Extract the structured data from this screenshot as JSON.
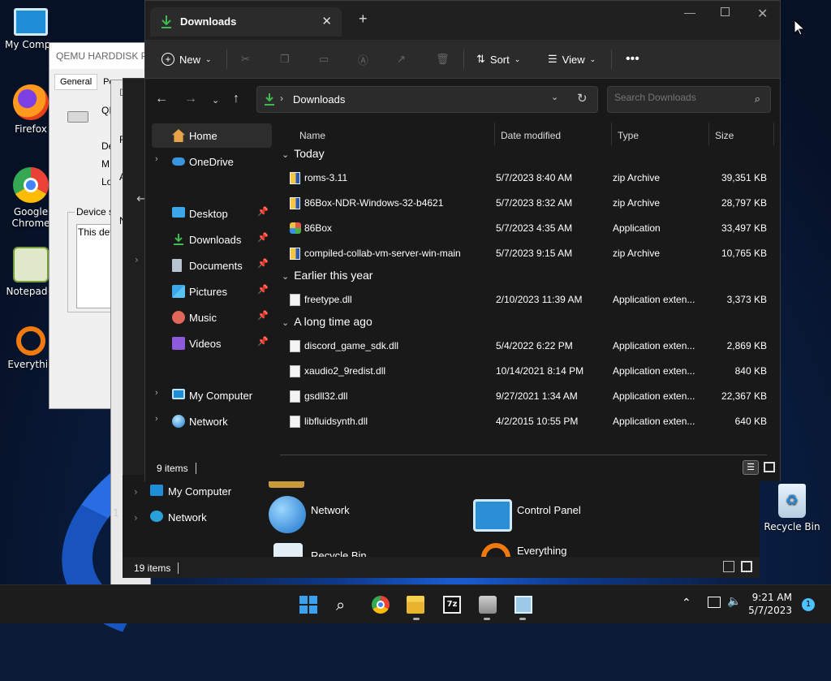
{
  "desktop": {
    "icons": [
      {
        "label": "My Compu",
        "icon": "monitor-icon"
      },
      {
        "label": "Firefox",
        "icon": "firefox-icon"
      },
      {
        "label": "Google Chrome",
        "icon": "chrome-icon"
      },
      {
        "label": "Notepad+",
        "icon": "notepad-plus-icon"
      },
      {
        "label": "Everythin",
        "icon": "everything-icon"
      },
      {
        "label": "Recycle Bin",
        "icon": "recycle-bin-icon"
      }
    ]
  },
  "props_window": {
    "title": "QEMU HARDDISK Pr",
    "tabs": [
      "General",
      "Po"
    ],
    "partial": [
      "QI",
      "De",
      "M",
      "Lo",
      "Device st",
      "This devi"
    ]
  },
  "back_explorer": {
    "partial": [
      "Di",
      "F",
      "A",
      "N"
    ],
    "sidebar": [
      {
        "label": "My Computer",
        "icon": "monitor-icon"
      },
      {
        "label": "Network",
        "icon": "network-icon"
      }
    ],
    "tiles": [
      {
        "label": "Network",
        "icon": "network-icon"
      },
      {
        "label": "Control Panel",
        "icon": "control-panel-icon"
      },
      {
        "label": "Recycle Bin",
        "icon": "recycle-bin-icon"
      },
      {
        "label": "Everything",
        "icon": "everything-icon"
      }
    ],
    "status": "19 items",
    "side_status": "1"
  },
  "explorer": {
    "tab_title": "Downloads",
    "toolbar": {
      "new": "New",
      "sort": "Sort",
      "view": "View"
    },
    "address": {
      "segment": "Downloads"
    },
    "search_placeholder": "Search Downloads",
    "sidebar": {
      "home": "Home",
      "onedrive": "OneDrive",
      "quick": [
        {
          "label": "Desktop",
          "icon": "desktop-icon"
        },
        {
          "label": "Downloads",
          "icon": "download-icon"
        },
        {
          "label": "Documents",
          "icon": "documents-icon"
        },
        {
          "label": "Pictures",
          "icon": "pictures-icon"
        },
        {
          "label": "Music",
          "icon": "music-icon"
        },
        {
          "label": "Videos",
          "icon": "videos-icon"
        }
      ],
      "mycomputer": "My Computer",
      "network": "Network"
    },
    "columns": {
      "name": "Name",
      "date": "Date modified",
      "type": "Type",
      "size": "Size"
    },
    "groups": [
      {
        "label": "Today",
        "files": [
          {
            "name": "roms-3.11",
            "date": "5/7/2023 8:40 AM",
            "type": "zip Archive",
            "size": "39,351 KB",
            "icon": "zip-icon"
          },
          {
            "name": "86Box-NDR-Windows-32-b4621",
            "date": "5/7/2023 8:32 AM",
            "type": "zip Archive",
            "size": "28,797 KB",
            "icon": "zip-icon"
          },
          {
            "name": "86Box",
            "date": "5/7/2023 4:35 AM",
            "type": "Application",
            "size": "33,497 KB",
            "icon": "app-icon"
          },
          {
            "name": "compiled-collab-vm-server-win-main",
            "date": "5/7/2023 9:15 AM",
            "type": "zip Archive",
            "size": "10,765 KB",
            "icon": "zip-icon"
          }
        ]
      },
      {
        "label": "Earlier this year",
        "files": [
          {
            "name": "freetype.dll",
            "date": "2/10/2023 11:39 AM",
            "type": "Application exten...",
            "size": "3,373 KB",
            "icon": "dll-icon"
          }
        ]
      },
      {
        "label": "A long time ago",
        "files": [
          {
            "name": "discord_game_sdk.dll",
            "date": "5/4/2022 6:22 PM",
            "type": "Application exten...",
            "size": "2,869 KB",
            "icon": "dll-icon"
          },
          {
            "name": "xaudio2_9redist.dll",
            "date": "10/14/2021 8:14 PM",
            "type": "Application exten...",
            "size": "840 KB",
            "icon": "dll-icon"
          },
          {
            "name": "gsdll32.dll",
            "date": "9/27/2021 1:34 AM",
            "type": "Application exten...",
            "size": "22,367 KB",
            "icon": "dll-icon"
          },
          {
            "name": "libfluidsynth.dll",
            "date": "4/2/2015 10:55 PM",
            "type": "Application exten...",
            "size": "640 KB",
            "icon": "dll-icon"
          }
        ]
      }
    ],
    "status": "9 items"
  },
  "taskbar": {
    "apps": [
      "start-icon",
      "search-icon",
      "chrome-icon",
      "file-explorer-icon",
      "7zip-icon",
      "device-manager-icon",
      "task-manager-icon"
    ],
    "time": "9:21 AM",
    "date": "5/7/2023",
    "notifications": "1"
  },
  "colors": {
    "accent": "#4cc2ff",
    "download_green": "#3fb950",
    "folder_yellow": "#f4c542"
  }
}
